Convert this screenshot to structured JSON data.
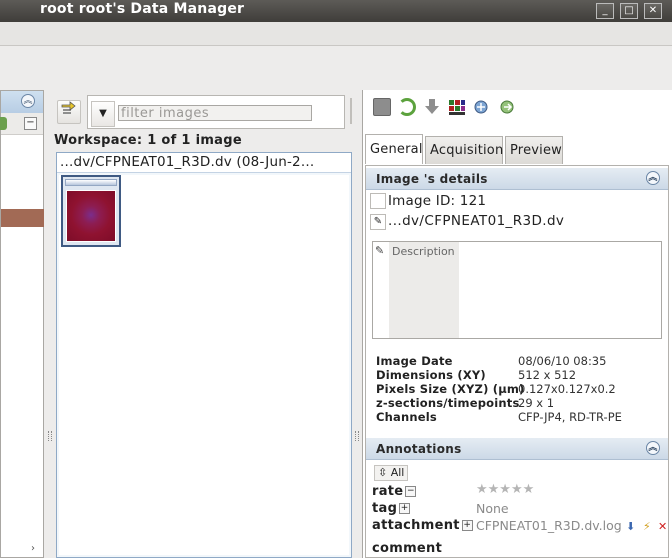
{
  "window": {
    "title": "root root's Data Manager",
    "controls": [
      "_",
      "□",
      "✕"
    ]
  },
  "left_panel": {
    "collapse_glyph": "︽"
  },
  "workspace": {
    "filter_placeholder": "filter  images",
    "dropdown_glyph": "▼",
    "label": "Workspace: 1 of 1 image",
    "file_header": "...dv/CFPNEAT01_R3D.dv (08-Jun-2..."
  },
  "right_panel": {
    "tabs": [
      "General",
      "Acquisition",
      "Preview"
    ],
    "active_tab": "General",
    "details_header": "Image 's details",
    "image_id_label": "Image  ID: 121",
    "image_name": "...dv/CFPNEAT01_R3D.dv",
    "description_label": "Description",
    "metadata": [
      {
        "key": "Image Date",
        "value": "08/06/10 08:35"
      },
      {
        "key": "Dimensions (XY)",
        "value": "512 x 512"
      },
      {
        "key": "Pixels Size (XYZ) (µm)",
        "value": "0.127x0.127x0.2"
      },
      {
        "key": "z-sections/timepoints",
        "value": "29 x 1"
      },
      {
        "key": "Channels",
        "value": "CFP-JP4, RD-TR-PE"
      }
    ],
    "annotations_header": "Annotations",
    "all_button": "All",
    "rate_label": "rate",
    "rate_stars": "★★★★★",
    "tag_label": "tag",
    "tag_value": "None",
    "attachment_label": "attachment",
    "attachment_value": "CFPNEAT01_R3D.dv.log",
    "comment_label": "comment"
  },
  "colors": {
    "accent": "#3f5a83",
    "selection": "#a26a55"
  }
}
